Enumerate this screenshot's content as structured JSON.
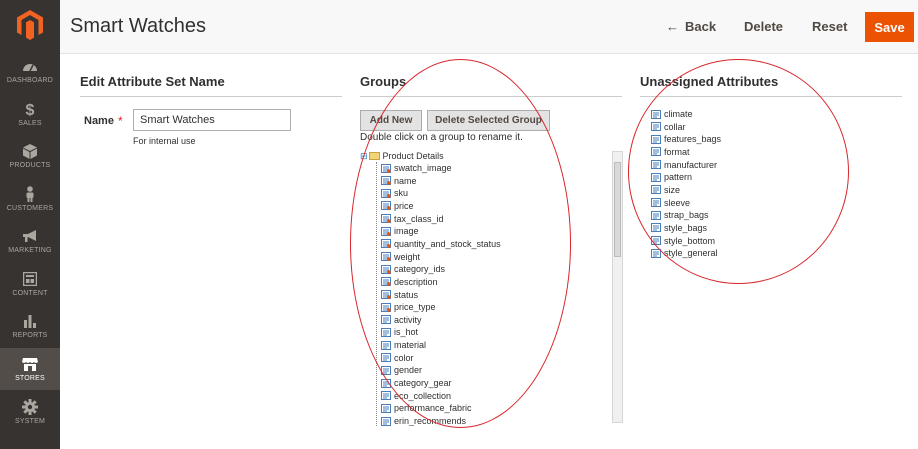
{
  "sidebar": {
    "items": [
      {
        "label": "DASHBOARD",
        "icon": "dashboard-icon"
      },
      {
        "label": "SALES",
        "icon": "dollar-icon"
      },
      {
        "label": "PRODUCTS",
        "icon": "cube-icon"
      },
      {
        "label": "CUSTOMERS",
        "icon": "person-icon"
      },
      {
        "label": "MARKETING",
        "icon": "megaphone-icon"
      },
      {
        "label": "CONTENT",
        "icon": "content-icon"
      },
      {
        "label": "REPORTS",
        "icon": "bar-chart-icon"
      },
      {
        "label": "STORES",
        "icon": "store-icon",
        "active": true
      },
      {
        "label": "SYSTEM",
        "icon": "gear-icon"
      }
    ]
  },
  "header": {
    "title": "Smart Watches",
    "back_label": "Back",
    "delete_label": "Delete",
    "reset_label": "Reset",
    "save_label": "Save"
  },
  "edit": {
    "title": "Edit Attribute Set Name",
    "name_label": "Name",
    "required_mark": "*",
    "name_value": "Smart Watches",
    "note": "For internal use"
  },
  "groups": {
    "title": "Groups",
    "add_new_label": "Add New",
    "delete_group_label": "Delete Selected Group",
    "hint": "Double click on a group to rename it.",
    "root_label": "Product Details",
    "items": [
      {
        "label": "swatch_image",
        "system": true
      },
      {
        "label": "name",
        "system": true
      },
      {
        "label": "sku",
        "system": true
      },
      {
        "label": "price",
        "system": true
      },
      {
        "label": "tax_class_id",
        "system": true
      },
      {
        "label": "image",
        "system": true
      },
      {
        "label": "quantity_and_stock_status",
        "system": true
      },
      {
        "label": "weight",
        "system": true
      },
      {
        "label": "category_ids",
        "system": true
      },
      {
        "label": "description",
        "system": true
      },
      {
        "label": "status",
        "system": true
      },
      {
        "label": "price_type",
        "system": true
      },
      {
        "label": "activity",
        "system": false
      },
      {
        "label": "is_hot",
        "system": false
      },
      {
        "label": "material",
        "system": false
      },
      {
        "label": "color",
        "system": false
      },
      {
        "label": "gender",
        "system": false
      },
      {
        "label": "category_gear",
        "system": false
      },
      {
        "label": "eco_collection",
        "system": false
      },
      {
        "label": "performance_fabric",
        "system": false
      },
      {
        "label": "erin_recommends",
        "system": false
      }
    ]
  },
  "unassigned": {
    "title": "Unassigned Attributes",
    "items": [
      "climate",
      "collar",
      "features_bags",
      "format",
      "manufacturer",
      "pattern",
      "size",
      "sleeve",
      "strap_bags",
      "style_bags",
      "style_bottom",
      "style_general"
    ]
  },
  "colors": {
    "sidebar_bg": "#373330",
    "accent": "#eb5202",
    "annotation": "#d9262c"
  }
}
